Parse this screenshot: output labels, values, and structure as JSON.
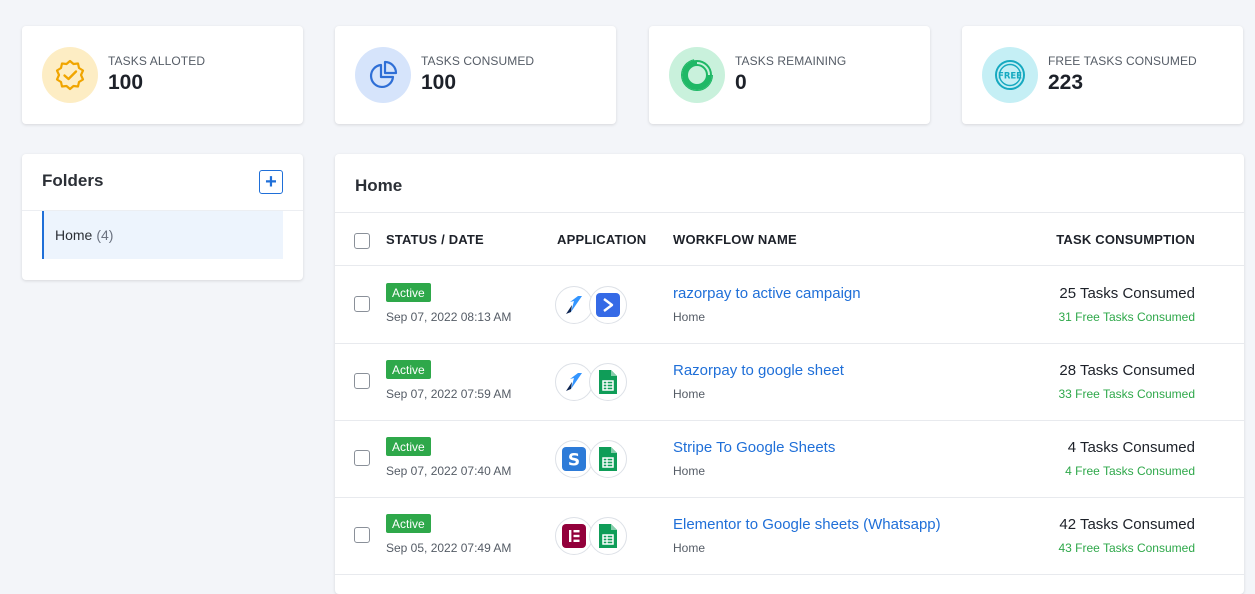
{
  "stats": [
    {
      "label": "TASKS ALLOTED",
      "value": "100",
      "icon": "verified-badge-icon",
      "bg": "#fdedc4",
      "fg": "#f0a500"
    },
    {
      "label": "TASKS CONSUMED",
      "value": "100",
      "icon": "pie-chart-icon",
      "bg": "#d6e4fb",
      "fg": "#2f6fd6"
    },
    {
      "label": "TASKS REMAINING",
      "value": "0",
      "icon": "donut-chart-icon",
      "bg": "#c9f1dc",
      "fg": "#1fb866"
    },
    {
      "label": "FREE TASKS CONSUMED",
      "value": "223",
      "icon": "free-badge-icon",
      "bg": "#c5eff5",
      "fg": "#16a9c0"
    }
  ],
  "folders": {
    "title": "Folders",
    "add_label": "+",
    "items": [
      {
        "name": "Home",
        "count": "(4)"
      }
    ]
  },
  "main": {
    "title": "Home",
    "columns": {
      "status": "STATUS / DATE",
      "application": "APPLICATION",
      "workflow": "WORKFLOW NAME",
      "tasks": "TASK CONSUMPTION"
    },
    "rows": [
      {
        "status": "Active",
        "date": "Sep 07, 2022 08:13 AM",
        "apps": [
          "razorpay-icon",
          "activecampaign-icon"
        ],
        "name": "razorpay to active campaign",
        "folder": "Home",
        "tasks": "25 Tasks Consumed",
        "free": "31 Free Tasks Consumed"
      },
      {
        "status": "Active",
        "date": "Sep 07, 2022 07:59 AM",
        "apps": [
          "razorpay-icon",
          "google-sheets-icon"
        ],
        "name": "Razorpay to google sheet",
        "folder": "Home",
        "tasks": "28 Tasks Consumed",
        "free": "33 Free Tasks Consumed"
      },
      {
        "status": "Active",
        "date": "Sep 07, 2022 07:40 AM",
        "apps": [
          "stripe-icon",
          "google-sheets-icon"
        ],
        "name": "Stripe To Google Sheets",
        "folder": "Home",
        "tasks": "4 Tasks Consumed",
        "free": "4 Free Tasks Consumed"
      },
      {
        "status": "Active",
        "date": "Sep 05, 2022 07:49 AM",
        "apps": [
          "elementor-icon",
          "google-sheets-icon"
        ],
        "name": "Elementor to Google sheets (Whatsapp)",
        "folder": "Home",
        "tasks": "42 Tasks Consumed",
        "free": "43 Free Tasks Consumed"
      }
    ]
  },
  "colors": {
    "accent": "#1f6fd8",
    "active": "#2ea84a",
    "background": "#f3f5f9"
  }
}
